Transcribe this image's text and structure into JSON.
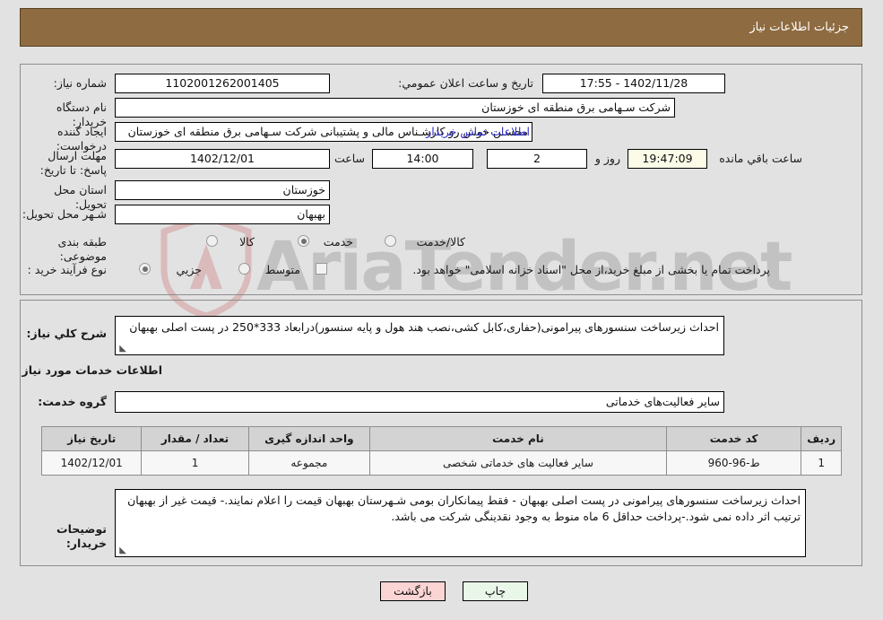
{
  "header": {
    "title": "جزئیات اطلاعات نیاز"
  },
  "form": {
    "need_number_label": "شماره نیاز:",
    "need_number_value": "1102001262001405",
    "announce_label": "تاریخ و ساعت اعلان عمومي:",
    "announce_value": "1402/11/28 - 17:55",
    "buyer_org_label": "نام دستگاه خریدار:",
    "buyer_org_value": "شرکت سـهامی برق منطقه ای خوزستان",
    "creator_label": "ایجاد کننده درخواست:",
    "creator_value": "محسـن خوش رو کارشـناس مالی و پشتیبانی شرکت سـهامی برق منطقه ای خوزستان",
    "contact_link": "اطلاعات تماس خریدار",
    "deadline_label": "مهلت ارسال پاسخ: تا تاریخ:",
    "deadline_date": "1402/12/01",
    "hour_label": "ساعت",
    "deadline_time": "14:00",
    "days_value": "2",
    "days_label": "روز و",
    "countdown_value": "19:47:09",
    "countdown_label": "ساعت باقي مانده",
    "province_label": "استان محل تحویل:",
    "province_value": "خوزستان",
    "city_label": "شـهر محل تحویل:",
    "city_value": "بهبهان",
    "category_label": "طبقه بندی موضوعی:",
    "category_options": [
      "کالا",
      "خدمت",
      "کالا/خدمت"
    ],
    "category_selected": "خدمت",
    "process_label": "نوع فرآیند خرید :",
    "process_options": [
      "جزیي",
      "متوسط"
    ],
    "process_selected": "جزیي",
    "treasury_checkbox_checked": false,
    "treasury_note": "پرداخت تمام یا بخشی از مبلغ خرید،از محل \"اسناد خزانه اسلامی\" خواهد بود."
  },
  "details": {
    "summary_label": "شرح کلي نیاز:",
    "summary_value": "احداث زیرساخت سنسورهای پیرامونی(حفاری،کابل کشی،نصب هند هول و پایه سنسور)درابعاد 333*250 در پست اصلی بهبهان",
    "services_heading": "اطلاعات خدمات مورد نیاز",
    "service_group_label": "گروه خدمت:",
    "service_group_value": "سایر فعالیت‌های خدماتی",
    "notes_label": "توضیحات خریدار:",
    "notes_value": "احداث زیرساخت سنسورهای پیرامونی  در پست اصلی بهبهان - فقط پیمانکاران بومی شـهرستان بهبهان قیمت را اعلام نمایند.- قیمت غیر از بهبهان ترتیب اثر داده نمی شود.-پرداخت حداقل 6 ماه منوط به وجود نقدینگی شرکت می باشد."
  },
  "table": {
    "columns": [
      "ردیف",
      "کد خدمت",
      "نام خدمت",
      "واحد اندازه گیری",
      "تعداد / مقدار",
      "تاریخ نیاز"
    ],
    "rows": [
      {
        "row": "1",
        "code": "ط-96-960",
        "name": "سایر فعالیت های خدماتی شخصی",
        "unit": "مجموعه",
        "qty": "1",
        "date": "1402/12/01"
      }
    ]
  },
  "footer": {
    "print_label": "چاپ",
    "back_label": "بازگشت"
  },
  "watermark": {
    "text": "AriaTender.net"
  },
  "colors": {
    "header_bg": "#8e6b41",
    "page_bg": "#e2e2e2",
    "link": "#2d2dd0",
    "print_btn": "#e9f7e9",
    "back_btn": "#fbd4d4",
    "timer_bg": "#fbfbe8"
  }
}
